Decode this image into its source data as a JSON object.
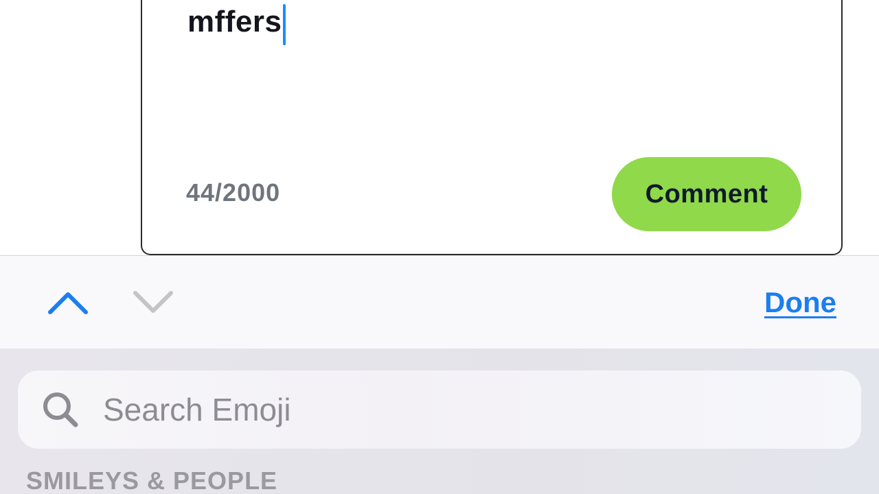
{
  "composer": {
    "text": "mffers",
    "char_count": "44/2000",
    "submit_label": "Comment",
    "accent_color": "#8fd94a"
  },
  "keyboard_toolbar": {
    "prev_icon": "chevron-up-icon",
    "next_icon": "chevron-down-icon",
    "done_label": "Done",
    "accent_color": "#1a7ef0"
  },
  "emoji_keyboard": {
    "search": {
      "placeholder": "Search Emoji",
      "value": "",
      "icon": "search-icon"
    },
    "category_label": "SMILEYS & PEOPLE"
  }
}
